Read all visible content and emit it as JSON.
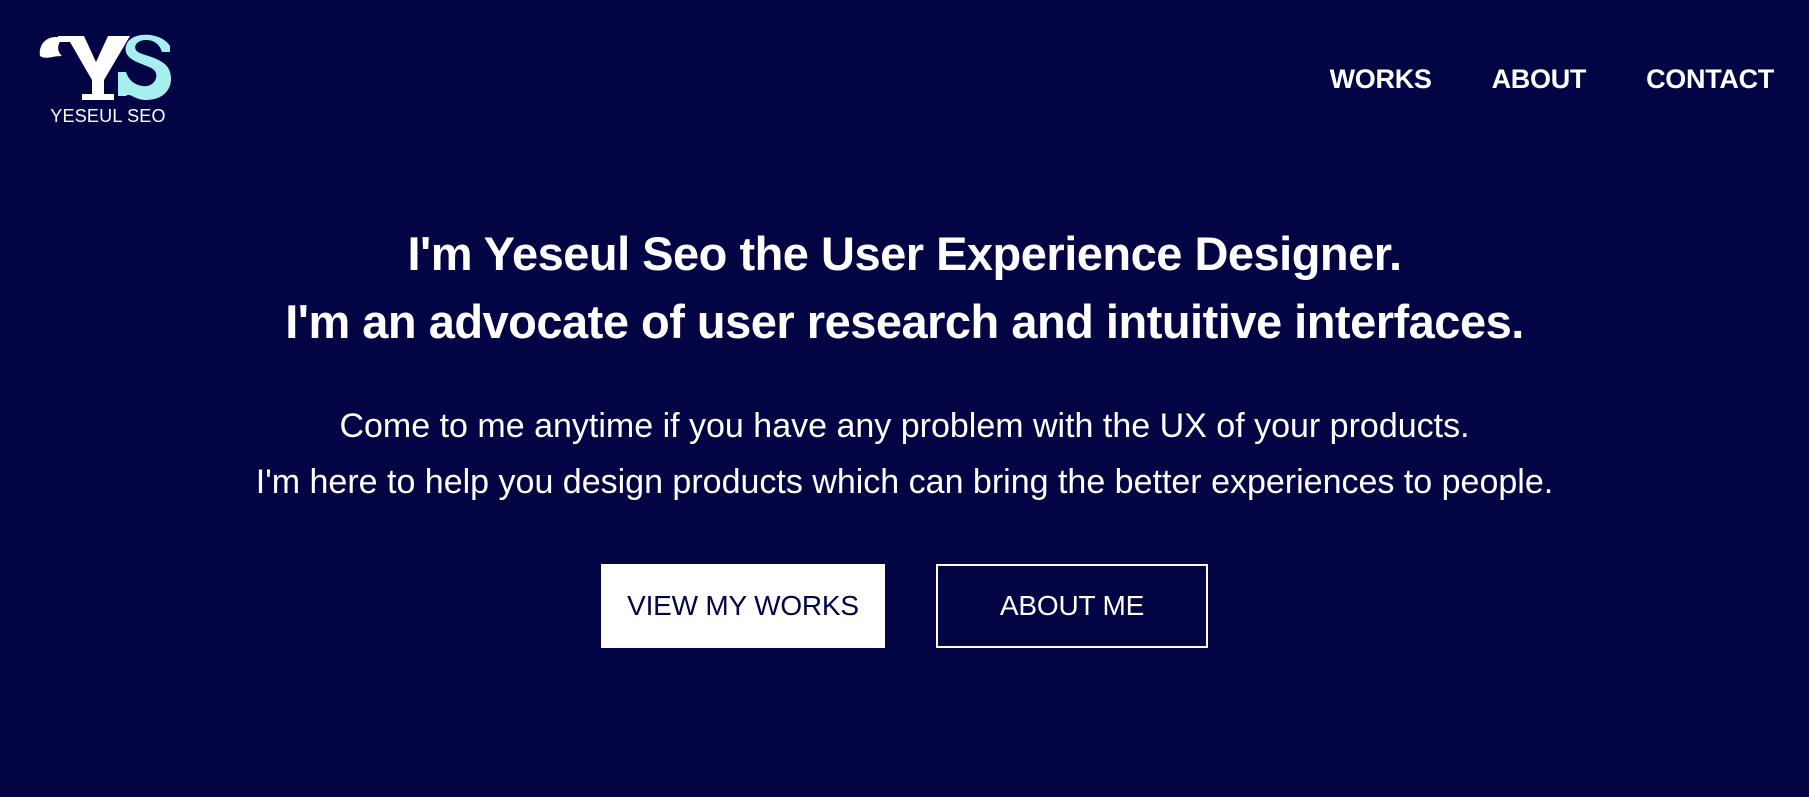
{
  "brand": {
    "logo_mark": "YS",
    "name": "YESEUL SEO",
    "colors": {
      "background": "#030444",
      "logo_letter_primary": "#ffffff",
      "logo_letter_accent": "#a7eef0",
      "text": "#ffffff"
    }
  },
  "nav": {
    "items": [
      {
        "label": "WORKS"
      },
      {
        "label": "ABOUT"
      },
      {
        "label": "CONTACT"
      }
    ]
  },
  "hero": {
    "headline_line1": "I'm Yeseul Seo the User Experience Designer.",
    "headline_line2": "I'm an advocate of user research and intuitive interfaces.",
    "sub_line1": "Come to me anytime if you have any problem with the UX of your products.",
    "sub_line2": "I'm here to help you design products which can bring the better experiences to people."
  },
  "cta": {
    "primary_label": "VIEW MY WORKS",
    "secondary_label": "ABOUT ME"
  }
}
